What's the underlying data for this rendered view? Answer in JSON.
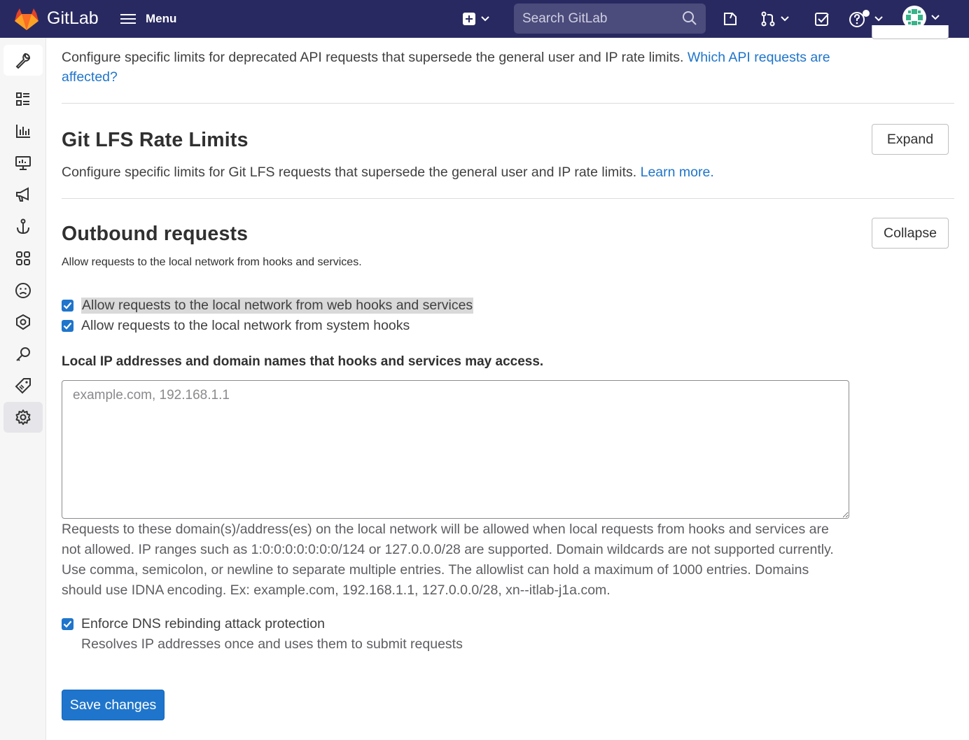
{
  "navbar": {
    "brand": "GitLab",
    "menu_label": "Menu",
    "search_placeholder": "Search GitLab"
  },
  "sidebar": {
    "items": [
      "admin-wrench",
      "overview",
      "analytics",
      "monitoring",
      "messages",
      "system-hooks",
      "applications",
      "abuse-reports",
      "kubernetes",
      "deploy-keys",
      "labels",
      "settings"
    ],
    "active": "settings"
  },
  "deprecated_api": {
    "description": "Configure specific limits for deprecated API requests that supersede the general user and IP rate limits. ",
    "link": "Which API requests are affected?"
  },
  "git_lfs": {
    "title": "Git LFS Rate Limits",
    "button": "Expand",
    "description": "Configure specific limits for Git LFS requests that supersede the general user and IP rate limits. ",
    "link": "Learn more."
  },
  "outbound": {
    "title": "Outbound requests",
    "button": "Collapse",
    "description": "Allow requests to the local network from hooks and services.",
    "checkbox_web_hooks": "Allow requests to the local network from web hooks and services",
    "checkbox_web_hooks_checked": true,
    "checkbox_system_hooks": "Allow requests to the local network from system hooks",
    "checkbox_system_hooks_checked": true,
    "allowlist_label": "Local IP addresses and domain names that hooks and services may access.",
    "allowlist_placeholder": "example.com, 192.168.1.1",
    "allowlist_value": "",
    "allowlist_help": "Requests to these domain(s)/address(es) on the local network will be allowed when local requests from hooks and services are not allowed. IP ranges such as 1:0:0:0:0:0:0:0/124 or 127.0.0.0/28 are supported. Domain wildcards are not supported currently. Use comma, semicolon, or newline to separate multiple entries. The allowlist can hold a maximum of 1000 entries. Domains should use IDNA encoding. Ex: example.com, 192.168.1.1, 127.0.0.0/28, xn--itlab-j1a.com.",
    "dns_checkbox": "Enforce DNS rebinding attack protection",
    "dns_checkbox_checked": true,
    "dns_help": "Resolves IP addresses once and uses them to submit requests",
    "save_button": "Save changes"
  },
  "colors": {
    "navbar": "#292961",
    "accent": "#1f75cb"
  }
}
